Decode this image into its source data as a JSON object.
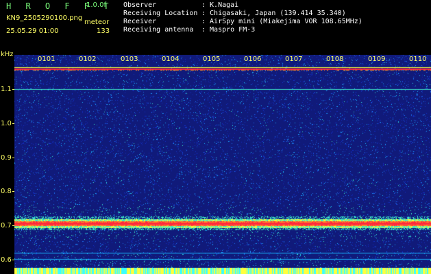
{
  "header": {
    "app_title": "H R O F F T",
    "version": "1.0.0f",
    "filename": "KN9_2505290100.png",
    "meteor_label": "meteor",
    "datetime": "25.05.29 01:00",
    "meteor_count": "133"
  },
  "info": [
    {
      "key": "Observer",
      "value": ": K.Nagai"
    },
    {
      "key": "Receiving Location",
      "value": ": Chigasaki, Japan (139.414 35.340)"
    },
    {
      "key": "Receiver",
      "value": ": AirSpy mini (Miakejima VOR 108.65MHz)"
    },
    {
      "key": "Receiving antenna",
      "value": ": Maspro FM-3"
    }
  ],
  "plot": {
    "unit": "kHz",
    "y_ticks": [
      "1.1",
      "1.0",
      "0.9",
      "0.8",
      "0.7",
      "0.6"
    ],
    "x_ticks": [
      "0101",
      "0102",
      "0103",
      "0104",
      "0105",
      "0106",
      "0107",
      "0108",
      "0109",
      "0110"
    ],
    "colors": {
      "background": "#101a7a",
      "noise": [
        "#1530c8",
        "#1e6ff0",
        "#19b4ff",
        "#3ce6c8"
      ],
      "strong_band": [
        "#ff2a3c",
        "#ff8c28",
        "#f0ff3c"
      ],
      "bottom_strip": [
        "#ffff3c",
        "#3cffff"
      ]
    }
  }
}
